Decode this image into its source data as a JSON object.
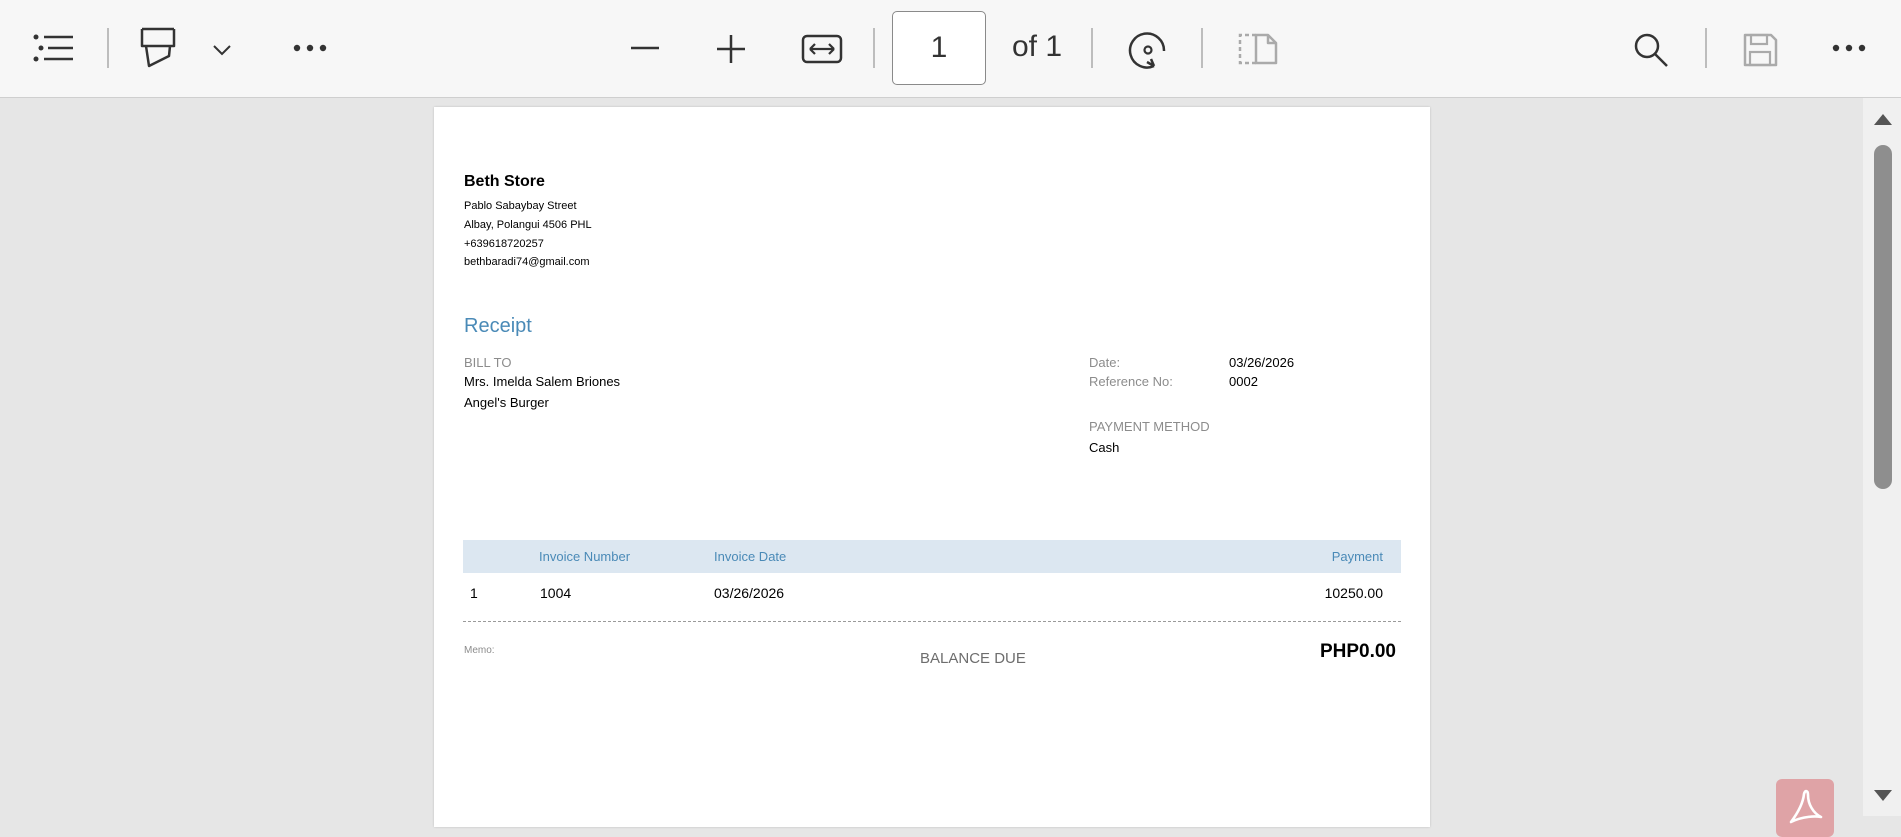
{
  "toolbar": {
    "icons": {
      "toc": "list-icon",
      "highlight": "highlighter-icon",
      "highlight_menu": "chevron-down-icon",
      "more_left": "more-icon",
      "zoom_out": "minus-icon",
      "zoom_in": "plus-icon",
      "fit_width": "fit-width-icon",
      "rotate": "rotate-icon",
      "two_page": "two-page-icon",
      "search": "search-icon",
      "save": "save-icon",
      "more_right": "more-icon"
    },
    "page_current": "1",
    "page_of": "of 1"
  },
  "document": {
    "store": {
      "name": "Beth Store",
      "street": "Pablo Sabaybay Street",
      "city": "Albay, Polangui  4506 PHL",
      "phone": "+639618720257",
      "email": "bethbaradi74@gmail.com"
    },
    "title": "Receipt",
    "bill_to": {
      "label": "BILL TO",
      "name": "Mrs. Imelda Salem Briones",
      "company": "Angel's Burger"
    },
    "meta": {
      "date_label": "Date:",
      "date_value": "03/26/2026",
      "ref_label": "Reference No:",
      "ref_value": "0002",
      "payment_method_label": "PAYMENT METHOD",
      "payment_method_value": "Cash"
    },
    "table": {
      "headers": [
        "",
        "Invoice Number",
        "Invoice Date",
        "Payment"
      ],
      "rows": [
        [
          "1",
          "1004",
          "03/26/2026",
          "10250.00"
        ]
      ]
    },
    "memo_label": "Memo:",
    "balance_due_label": "BALANCE DUE",
    "balance_due_value": "PHP0.00"
  },
  "colors": {
    "accent": "#4a8ab7",
    "table_header_bg": "#dce7f1",
    "acrobat_badge": "#dfa3a6"
  }
}
